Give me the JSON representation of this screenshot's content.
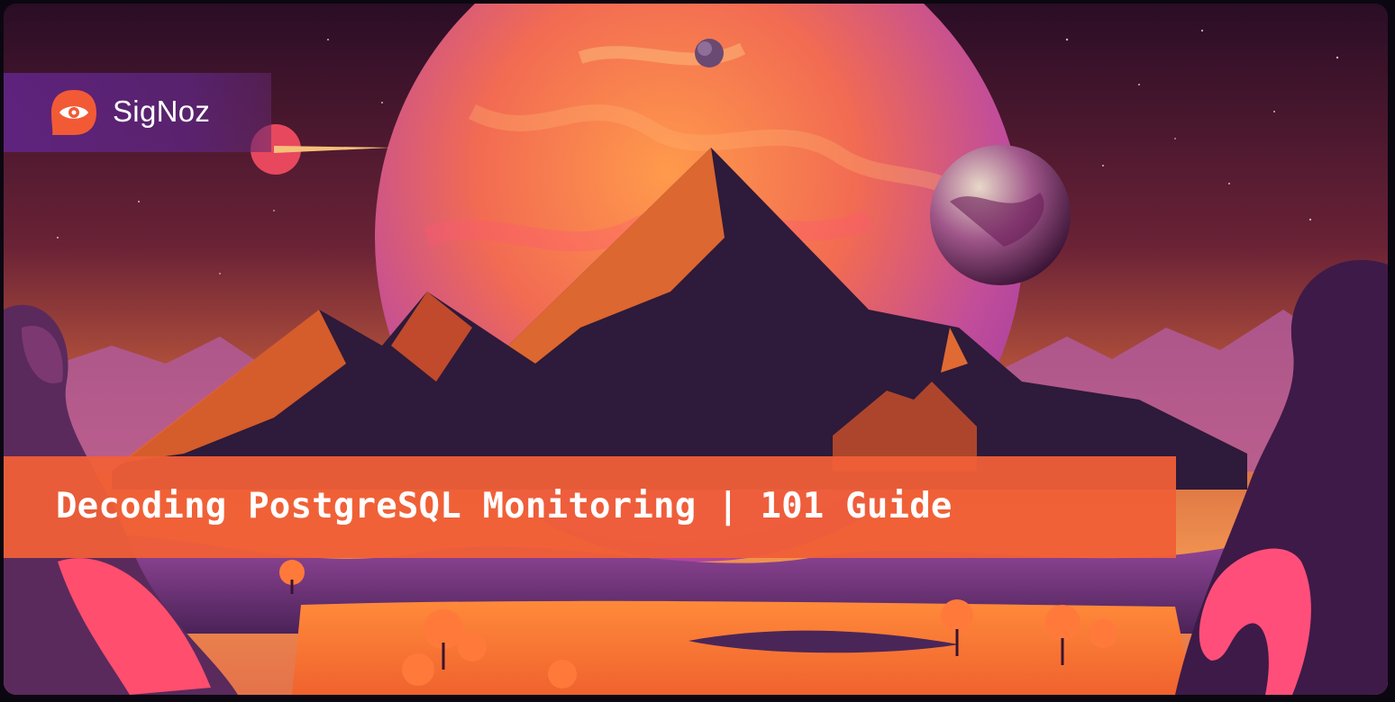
{
  "brand": {
    "name": "SigNoz",
    "logo_icon": "signoz-eye-logo-icon",
    "accent_color": "#f25a36"
  },
  "banner": {
    "title": "Decoding PostgreSQL Monitoring | 101 Guide",
    "band_color": "#f05f37"
  },
  "artwork": {
    "palette": [
      "#2b0f2a",
      "#f07a3a",
      "#b0408c",
      "#6a2e8c",
      "#ff4e6e"
    ]
  }
}
